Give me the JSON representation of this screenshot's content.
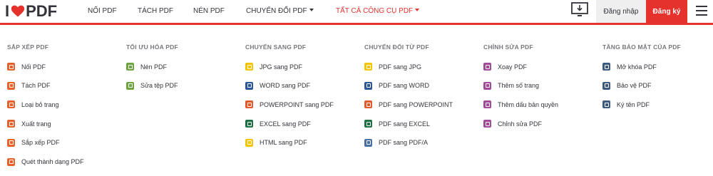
{
  "brand": {
    "logo_i": "I",
    "logo_pdf": "PDF",
    "accent": "#e5322d"
  },
  "nav": {
    "merge": "NỐI PDF",
    "split": "TÁCH PDF",
    "compress": "NÉN PDF",
    "convert": "CHUYỂN ĐỔI PDF",
    "all_tools": "TẤT CẢ CÔNG CỤ PDF"
  },
  "header": {
    "login": "Đăng nhập",
    "signup": "Đăng ký"
  },
  "columns": [
    {
      "title": "SẮP XẾP PDF",
      "items": [
        {
          "label": "Nối PDF",
          "icon": "merge-icon",
          "color": "#e5622d"
        },
        {
          "label": "Tách PDF",
          "icon": "split-icon",
          "color": "#e5622d"
        },
        {
          "label": "Loại bỏ trang",
          "icon": "remove-pages-icon",
          "color": "#e5622d"
        },
        {
          "label": "Xuất trang",
          "icon": "extract-pages-icon",
          "color": "#e5622d"
        },
        {
          "label": "Sắp xếp PDF",
          "icon": "organize-icon",
          "color": "#e5622d"
        },
        {
          "label": "Quét thành dạng PDF",
          "icon": "scan-icon",
          "color": "#e5622d"
        }
      ]
    },
    {
      "title": "TỐI ƯU HÓA PDF",
      "items": [
        {
          "label": "Nén PDF",
          "icon": "compress-icon",
          "color": "#6ea541"
        },
        {
          "label": "Sửa tệp PDF",
          "icon": "repair-icon",
          "color": "#6ea541"
        }
      ]
    },
    {
      "title": "CHUYỂN SANG PDF",
      "items": [
        {
          "label": "JPG sang PDF",
          "icon": "jpg-icon",
          "color": "#f4c500"
        },
        {
          "label": "WORD sang PDF",
          "icon": "word-icon",
          "color": "#2b5797"
        },
        {
          "label": "POWERPOINT sang PDF",
          "icon": "powerpoint-icon",
          "color": "#e35b2c"
        },
        {
          "label": "EXCEL sang PDF",
          "icon": "excel-icon",
          "color": "#1e7145"
        },
        {
          "label": "HTML sang PDF",
          "icon": "html-icon",
          "color": "#f4c500"
        }
      ]
    },
    {
      "title": "CHUYỂN ĐỔI TỪ PDF",
      "items": [
        {
          "label": "PDF sang JPG",
          "icon": "pdf-jpg-icon",
          "color": "#f4c500"
        },
        {
          "label": "PDF sang WORD",
          "icon": "pdf-word-icon",
          "color": "#2b5797"
        },
        {
          "label": "PDF sang POWERPOINT",
          "icon": "pdf-powerpoint-icon",
          "color": "#e35b2c"
        },
        {
          "label": "PDF sang EXCEL",
          "icon": "pdf-excel-icon",
          "color": "#1e7145"
        },
        {
          "label": "PDF sang PDF/A",
          "icon": "pdfa-icon",
          "color": "#4a6fa5"
        }
      ]
    },
    {
      "title": "CHỈNH SỬA PDF",
      "items": [
        {
          "label": "Xoay PDF",
          "icon": "rotate-icon",
          "color": "#a24a9a"
        },
        {
          "label": "Thêm số trang",
          "icon": "page-numbers-icon",
          "color": "#a24a9a"
        },
        {
          "label": "Thêm dấu bản quyền",
          "icon": "watermark-icon",
          "color": "#a24a9a"
        },
        {
          "label": "Chỉnh sửa PDF",
          "icon": "edit-icon",
          "color": "#a24a9a"
        }
      ]
    },
    {
      "title": "TĂNG BẢO MẬT CỦA PDF",
      "items": [
        {
          "label": "Mở khóa PDF",
          "icon": "unlock-icon",
          "color": "#3d5a80"
        },
        {
          "label": "Bảo vệ PDF",
          "icon": "protect-icon",
          "color": "#3d5a80"
        },
        {
          "label": "Ký tên PDF",
          "icon": "sign-icon",
          "color": "#3d5a80"
        }
      ]
    }
  ]
}
